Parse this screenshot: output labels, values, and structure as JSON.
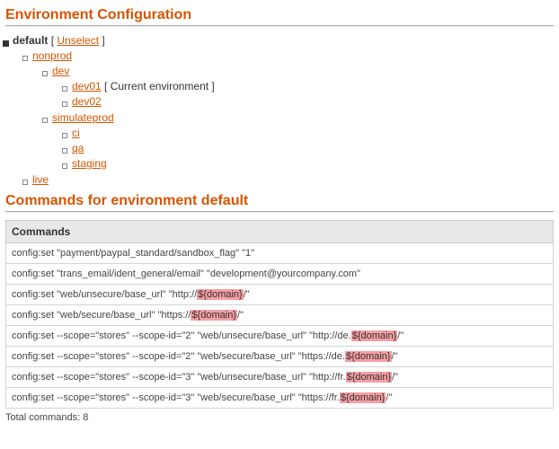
{
  "section1_title": "Environment Configuration",
  "tree": {
    "root": "default",
    "unselect": "Unselect",
    "nonprod": "nonprod",
    "dev": "dev",
    "dev01": "dev01",
    "dev01_suffix": " [ Current environment ]",
    "dev02": "dev02",
    "simulateprod": "simulateprod",
    "ci": "ci",
    "qa": "qa",
    "staging": "staging",
    "live": "live"
  },
  "section2_title": "Commands for environment default",
  "commands_header": "Commands",
  "commands": [
    [
      {
        "t": "config:set \"payment/paypal_standard/sandbox_flag\" \"1\""
      }
    ],
    [
      {
        "t": "config:set \"trans_email/ident_general/email\" \"development@yourcompany.com\""
      }
    ],
    [
      {
        "t": "config:set \"web/unsecure/base_url\" \"http://"
      },
      {
        "t": "${domain}",
        "h": true
      },
      {
        "t": "/\""
      }
    ],
    [
      {
        "t": "config:set \"web/secure/base_url\" \"https://"
      },
      {
        "t": "${domain}",
        "h": true
      },
      {
        "t": "/\""
      }
    ],
    [
      {
        "t": "config:set --scope=\"stores\" --scope-id=\"2\" \"web/unsecure/base_url\" \"http://de."
      },
      {
        "t": "${domain}",
        "h": true
      },
      {
        "t": "/\""
      }
    ],
    [
      {
        "t": "config:set --scope=\"stores\" --scope-id=\"2\" \"web/secure/base_url\" \"https://de."
      },
      {
        "t": "${domain}",
        "h": true
      },
      {
        "t": "/\""
      }
    ],
    [
      {
        "t": "config:set --scope=\"stores\" --scope-id=\"3\" \"web/unsecure/base_url\" \"http://fr."
      },
      {
        "t": "${domain}",
        "h": true
      },
      {
        "t": "/\""
      }
    ],
    [
      {
        "t": "config:set --scope=\"stores\" --scope-id=\"3\" \"web/secure/base_url\" \"https://fr."
      },
      {
        "t": "${domain}",
        "h": true
      },
      {
        "t": "/\""
      }
    ]
  ],
  "total_label": "Total commands: 8"
}
